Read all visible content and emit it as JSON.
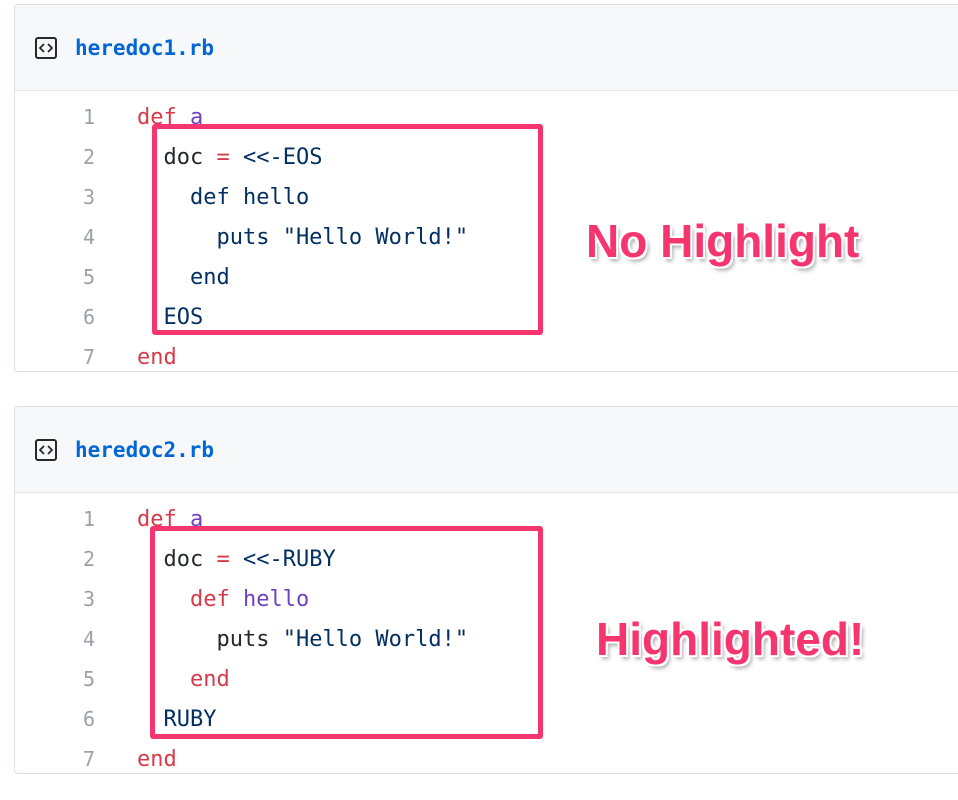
{
  "gists": [
    {
      "filename": "heredoc1.rb",
      "lines": [
        {
          "n": "1",
          "tokens": [
            {
              "t": "def",
              "c": "k"
            },
            {
              "t": " "
            },
            {
              "t": "a",
              "c": "f"
            }
          ]
        },
        {
          "n": "2",
          "tokens": [
            {
              "t": "  doc "
            },
            {
              "t": "=",
              "c": "k"
            },
            {
              "t": " <<-EOS",
              "c": "s"
            }
          ]
        },
        {
          "n": "3",
          "tokens": [
            {
              "t": "    def hello",
              "c": "s"
            }
          ]
        },
        {
          "n": "4",
          "tokens": [
            {
              "t": "      puts \"Hello World!\"",
              "c": "s"
            }
          ]
        },
        {
          "n": "5",
          "tokens": [
            {
              "t": "    end",
              "c": "s"
            }
          ]
        },
        {
          "n": "6",
          "tokens": [
            {
              "t": "  EOS",
              "c": "s"
            }
          ]
        },
        {
          "n": "7",
          "tokens": [
            {
              "t": "end",
              "c": "k"
            }
          ]
        }
      ]
    },
    {
      "filename": "heredoc2.rb",
      "lines": [
        {
          "n": "1",
          "tokens": [
            {
              "t": "def",
              "c": "k"
            },
            {
              "t": " "
            },
            {
              "t": "a",
              "c": "f"
            }
          ]
        },
        {
          "n": "2",
          "tokens": [
            {
              "t": "  doc "
            },
            {
              "t": "=",
              "c": "k"
            },
            {
              "t": " <<-RUBY",
              "c": "s"
            }
          ]
        },
        {
          "n": "3",
          "tokens": [
            {
              "t": "    "
            },
            {
              "t": "def",
              "c": "k"
            },
            {
              "t": " "
            },
            {
              "t": "hello",
              "c": "f"
            }
          ]
        },
        {
          "n": "4",
          "tokens": [
            {
              "t": "      puts "
            },
            {
              "t": "\"Hello World!\"",
              "c": "s"
            }
          ]
        },
        {
          "n": "5",
          "tokens": [
            {
              "t": "    "
            },
            {
              "t": "end",
              "c": "k"
            }
          ]
        },
        {
          "n": "6",
          "tokens": [
            {
              "t": "  RUBY",
              "c": "s"
            }
          ]
        },
        {
          "n": "7",
          "tokens": [
            {
              "t": "end",
              "c": "k"
            }
          ]
        }
      ]
    }
  ],
  "annotations": {
    "callout1": "No Highlight",
    "callout2": "Highlighted!"
  },
  "colors": {
    "annotation": "#f5356d",
    "keyword": "#d73a49",
    "function": "#6f42c1",
    "string": "#032f62",
    "filename": "#0366d6"
  },
  "icons": {
    "file": "code-file-icon"
  }
}
